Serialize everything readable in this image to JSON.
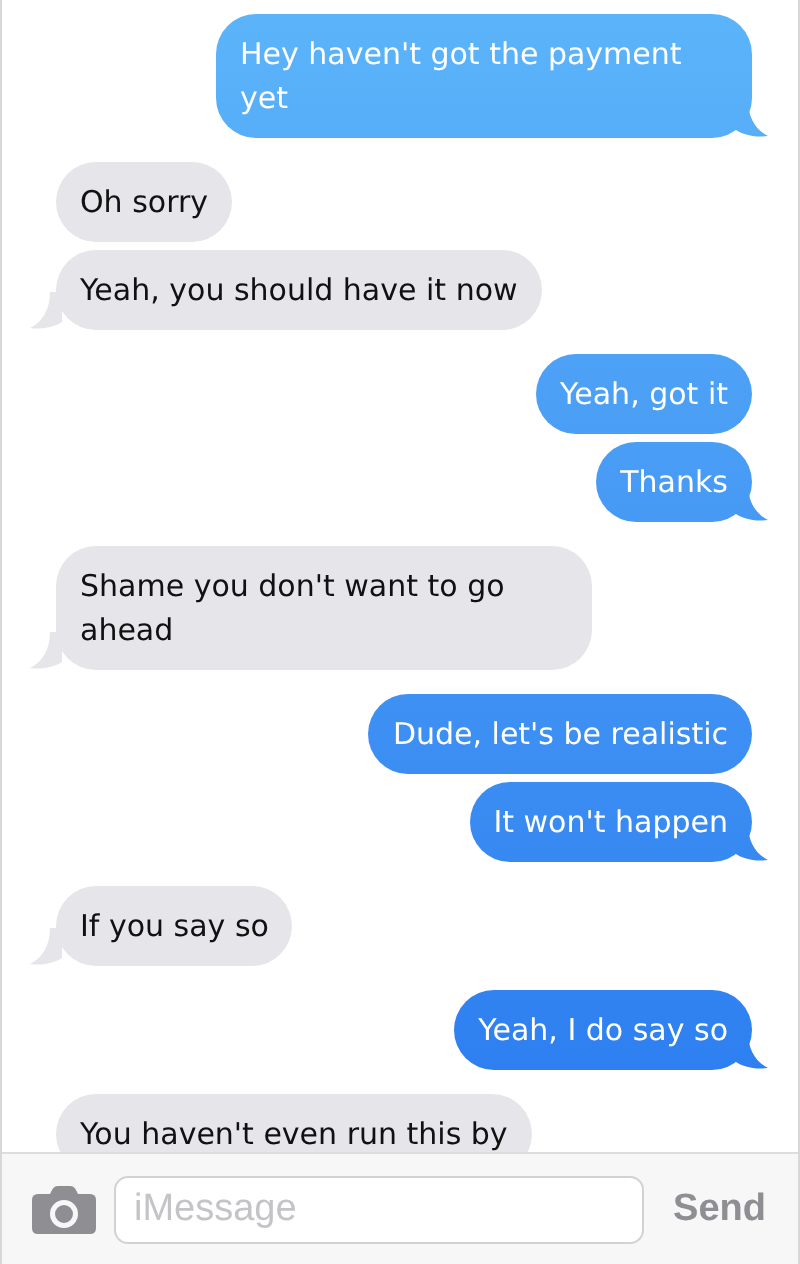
{
  "messages": [
    {
      "kind": "sent",
      "text": "Hey haven't got the payment yet",
      "tail": true
    },
    {
      "kind": "received",
      "text": "Oh sorry",
      "tail": false
    },
    {
      "kind": "received",
      "text": "Yeah, you should have it now",
      "tail": true
    },
    {
      "kind": "sent",
      "text": "Yeah, got it",
      "tail": false
    },
    {
      "kind": "sent",
      "text": "Thanks",
      "tail": true
    },
    {
      "kind": "received",
      "text": "Shame you don't want to go ahead",
      "tail": true
    },
    {
      "kind": "sent",
      "text": "Dude, let's be realistic",
      "tail": false
    },
    {
      "kind": "sent",
      "text": "It won't happen",
      "tail": true
    },
    {
      "kind": "received",
      "text": "If you say so",
      "tail": true
    },
    {
      "kind": "sent",
      "text": "Yeah, I do say so",
      "tail": true
    },
    {
      "kind": "received",
      "text": "You haven't even run this by"
    }
  ],
  "composer": {
    "placeholder": "iMessage",
    "send_label": "Send"
  }
}
